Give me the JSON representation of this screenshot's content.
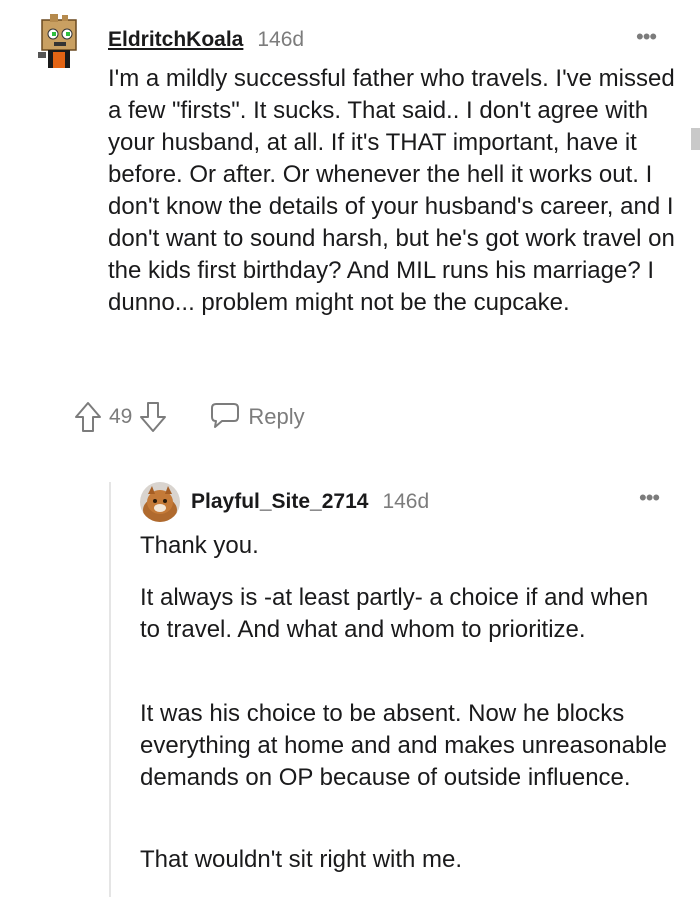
{
  "comments": [
    {
      "username": "EldritchKoala",
      "age": "146d",
      "more": "•••",
      "paragraphs": [
        "I'm a mildly successful father who travels. I've missed a few \"firsts\". It sucks. That said.. I don't agree with your husband, at all. If it's THAT important, have it before. Or after. Or whenever the hell it works out. I don't know the details of your husband's career, and I don't want to sound harsh, but he's got work travel on the kids first birthday? And MIL runs his marriage? I dunno... problem might not be the cupcake."
      ],
      "score": "49",
      "reply_label": "Reply"
    },
    {
      "username": "Playful_Site_2714",
      "age": "146d",
      "more": "•••",
      "paragraphs": [
        "Thank you.",
        "It always is -at least partly- a choice if and when to travel. And what and whom to prioritize.",
        "It was his choice to be absent. Now he blocks everything at home and and makes unreasonable demands on OP because of outside influence.",
        "That wouldn't sit right with me."
      ]
    }
  ],
  "colors": {
    "text": "#1a1a1b",
    "meta": "#7c7c7c",
    "thread_line": "#e5e5e5"
  }
}
